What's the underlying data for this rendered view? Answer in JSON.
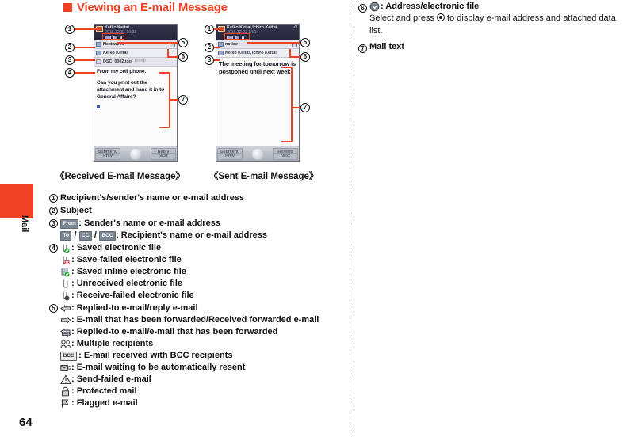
{
  "page": {
    "number": "64",
    "side_tab_label": "Mail"
  },
  "heading": {
    "text": "Viewing an E-mail Message"
  },
  "screens": {
    "received": {
      "caption": "《Received E-mail Message》",
      "titlebar": {
        "name": "Keiko Keitai",
        "date": "2016.12.31 10:38",
        "count": ""
      },
      "subject_row": "Next week",
      "address_row": "Keiko Keitai",
      "attachment_row": "DSC_0002.jpg",
      "attachment_size": "196KB",
      "body": [
        "From my cell phone.",
        "Can you print out the attachment and hand it in to General Affairs?"
      ],
      "softkeys": {
        "top_left": "Submenu",
        "top_right": "Reply",
        "bottom_left": "Prev",
        "bottom_right": "Next"
      }
    },
    "sent": {
      "caption": "《Sent E-mail Message》",
      "titlebar": {
        "name": "Keiko Keitai,Ichiro Keitai",
        "date": "2016.12.22 14:14",
        "count": "(2)"
      },
      "subject_row": "notice",
      "address_row": "Keiko Keitai, Ichiro Keitai",
      "body": [
        "The meeting for tomorrow is postponed until next week."
      ],
      "softkeys": {
        "top_left": "Submenu",
        "top_right": "Resend",
        "bottom_left": "Prev",
        "bottom_right": "Next"
      }
    }
  },
  "callouts": {
    "n1": "1",
    "n2": "2",
    "n3": "3",
    "n4": "4",
    "n5": "5",
    "n6": "6",
    "n7": "7"
  },
  "legend": {
    "item1": {
      "num": "1",
      "text": "Recipient's/sender's name or e-mail address"
    },
    "item2": {
      "num": "2",
      "text": "Subject"
    },
    "item3": {
      "num": "3",
      "chip_from": "From",
      "text_from": ": Sender's name or e-mail address",
      "chip_to": "To",
      "chip_cc": "CC",
      "chip_bcc": "BCC",
      "sep": "/",
      "text_to": ": Recipient's name or e-mail address"
    },
    "item4": {
      "num": "4",
      "lines": [
        {
          "icon": "saved-file-icon",
          "text": ": Saved electronic file"
        },
        {
          "icon": "save-failed-file-icon",
          "text": ": Save-failed electronic file"
        },
        {
          "icon": "saved-inline-file-icon",
          "text": ": Saved inline electronic file"
        },
        {
          "icon": "unreceived-file-icon",
          "text": ": Unreceived electronic file"
        },
        {
          "icon": "receive-failed-file-icon",
          "text": ": Receive-failed electronic file"
        }
      ]
    },
    "item5": {
      "num": "5",
      "lines": [
        {
          "icon": "reply-arrow-icon",
          "text": ": Replied-to e-mail/reply e-mail"
        },
        {
          "icon": "forward-arrow-icon",
          "text": ": E-mail that has been forwarded/Received forwarded e-mail"
        },
        {
          "icon": "reply-forward-arrow-icon",
          "text": ": Replied-to e-mail/e-mail that has been forwarded"
        },
        {
          "icon": "multiple-recipients-icon",
          "text": ": Multiple recipients"
        },
        {
          "icon": "bcc-icon",
          "chip": "BCC",
          "text": ": E-mail received with BCC recipients"
        },
        {
          "icon": "auto-resend-icon",
          "text": ": E-mail waiting to be automatically resent"
        },
        {
          "icon": "send-failed-icon",
          "text": ": Send-failed e-mail"
        },
        {
          "icon": "protected-mail-icon",
          "text": ": Protected mail"
        },
        {
          "icon": "flagged-mail-icon",
          "text": ": Flagged e-mail"
        }
      ]
    }
  },
  "right_column": {
    "item6": {
      "num": "6",
      "icon": "chevron-down-icon",
      "title": ": Address/electronic file",
      "desc_before": "Select and press ",
      "desc_after": " to display e-mail address and attached data list."
    },
    "item7": {
      "num": "7",
      "title": "Mail text"
    }
  },
  "colors": {
    "accent": "#ef4123",
    "text": "#111111"
  }
}
